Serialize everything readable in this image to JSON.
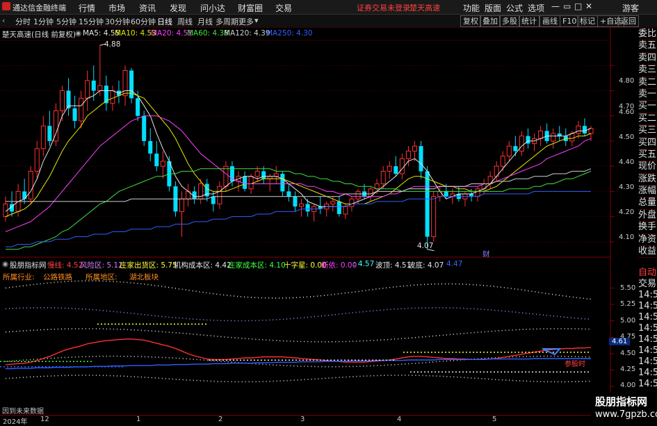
{
  "titlebar": {
    "app_name": "通达信金融终端",
    "menus": [
      "行情",
      "市场",
      "资讯",
      "发现",
      "问小达",
      "财富圈",
      "交易"
    ],
    "notice_login": "证券交易未登录",
    "notice_stock": "楚天高速",
    "right_menus": [
      "功能",
      "版面",
      "公式",
      "选项"
    ],
    "guest": "游客"
  },
  "toolbar": {
    "periods": [
      "分时",
      "1分钟",
      "5分钟",
      "15分钟",
      "30分钟",
      "60分钟",
      "日线",
      "周线",
      "月线",
      "多周期",
      "更多"
    ],
    "active": "日线",
    "right_buttons": [
      "复权",
      "叠加",
      "多股",
      "统计",
      "画线",
      "F10",
      "标记",
      "+自选",
      "返回"
    ]
  },
  "main": {
    "stock_title": "楚天高速(日线 前复权)",
    "ma_labels": [
      {
        "text": "MA5: 4.55",
        "color": "#e6e6e6"
      },
      {
        "text": "MA10: 4.53",
        "color": "#e6e600"
      },
      {
        "text": "MA20: 4.51",
        "color": "#ff40ff"
      },
      {
        "text": "MA60: 4.38",
        "color": "#40e040"
      },
      {
        "text": "MA120: 4.39",
        "color": "#d0d0d0"
      },
      {
        "text": "MA250: 4.30",
        "color": "#3060ff"
      }
    ],
    "high_label": "4.88",
    "low_label": "4.07",
    "cai_label": "财",
    "price_ticks": [
      "4.80",
      "4.70",
      "4.60",
      "4.50",
      "4.40",
      "4.30",
      "4.20",
      "4.10"
    ]
  },
  "indicator": {
    "name": "股朋指标网",
    "items": [
      {
        "text": "慢线: 4.52",
        "color": "#ff4040"
      },
      {
        "text": "风险区: 5.12",
        "color": "#d080ff"
      },
      {
        "text": "庄家出货区: 5.75",
        "color": "#ffff40"
      },
      {
        "text": "机构成本区: 4.42",
        "color": "#e6e6e6"
      },
      {
        "text": "庄家成本区: 4.10",
        "color": "#40ff40"
      },
      {
        "text": "十字星: 0.00",
        "color": "#ffff40"
      },
      {
        "text": "断依: 0.00",
        "color": "#ff40ff"
      },
      {
        "text": ": 4.57",
        "color": "#40ffff"
      },
      {
        "text": "波顶: 4.51",
        "color": "#e6e6e6"
      },
      {
        "text": "波底: 4.07",
        "color": "#e6e6e6"
      },
      {
        "text": "4.47",
        "color": "#4060ff"
      }
    ],
    "industry_label": "所属行业:",
    "industry_value": "公路铁路",
    "region_label": "所属地区:",
    "region_value": "湖北板块",
    "ticks": [
      "5.50",
      "5.25",
      "5.00",
      "4.75",
      "4.50",
      "4.25",
      "4.00"
    ],
    "current_value": "4.61",
    "buy_tag": "参股时",
    "footer_note": "因到未来数据"
  },
  "xaxis": {
    "labels": [
      "2024年",
      "12",
      "1",
      "2",
      "3",
      "4",
      "5"
    ]
  },
  "sidebar": {
    "items": [
      "委比",
      "卖五",
      "卖四",
      "卖三",
      "卖二",
      "卖一",
      "买一",
      "买二",
      "买三",
      "买四",
      "买五",
      "现价",
      "涨跌",
      "涨幅",
      "总量",
      "外盘",
      "换手",
      "净资",
      "收益"
    ],
    "lower": [
      "自动",
      "交易",
      "14:56",
      "14:56",
      "14:56",
      "14:56",
      "14:56",
      "14:56",
      "14:56",
      "14:56",
      "14:56"
    ]
  },
  "watermark": {
    "title": "股朋指标网",
    "url": "www.7gpzb.com"
  },
  "chart_data": {
    "type": "candlestick",
    "title": "楚天高速(日线 前复权)",
    "x_labels": [
      "2024年",
      "12",
      "1",
      "2",
      "3",
      "4",
      "5"
    ],
    "y_ticks": [
      4.1,
      4.2,
      4.3,
      4.4,
      4.5,
      4.6,
      4.7,
      4.8
    ],
    "ylim": [
      4.05,
      4.9
    ],
    "ohlc": [
      [
        4.2,
        4.28,
        4.18,
        4.25
      ],
      [
        4.25,
        4.3,
        4.2,
        4.22
      ],
      [
        4.22,
        4.33,
        4.2,
        4.3
      ],
      [
        4.3,
        4.35,
        4.25,
        4.27
      ],
      [
        4.27,
        4.4,
        4.25,
        4.38
      ],
      [
        4.38,
        4.5,
        4.35,
        4.47
      ],
      [
        4.47,
        4.6,
        4.44,
        4.56
      ],
      [
        4.56,
        4.62,
        4.48,
        4.5
      ],
      [
        4.5,
        4.65,
        4.48,
        4.62
      ],
      [
        4.62,
        4.72,
        4.58,
        4.7
      ],
      [
        4.7,
        4.75,
        4.6,
        4.63
      ],
      [
        4.63,
        4.68,
        4.55,
        4.58
      ],
      [
        4.58,
        4.7,
        4.55,
        4.67
      ],
      [
        4.67,
        4.78,
        4.62,
        4.74
      ],
      [
        4.74,
        4.8,
        4.66,
        4.7
      ],
      [
        4.7,
        4.88,
        4.68,
        4.72
      ],
      [
        4.72,
        4.76,
        4.62,
        4.65
      ],
      [
        4.65,
        4.72,
        4.62,
        4.7
      ],
      [
        4.7,
        4.74,
        4.65,
        4.68
      ],
      [
        4.68,
        4.8,
        4.64,
        4.78
      ],
      [
        4.78,
        4.79,
        4.65,
        4.67
      ],
      [
        4.67,
        4.7,
        4.58,
        4.6
      ],
      [
        4.6,
        4.62,
        4.48,
        4.5
      ],
      [
        4.5,
        4.55,
        4.42,
        4.45
      ],
      [
        4.45,
        4.5,
        4.38,
        4.4
      ],
      [
        4.4,
        4.46,
        4.35,
        4.42
      ],
      [
        4.42,
        4.44,
        4.3,
        4.32
      ],
      [
        4.32,
        4.34,
        4.2,
        4.22
      ],
      [
        4.22,
        4.3,
        4.12,
        4.27
      ],
      [
        4.27,
        4.33,
        4.24,
        4.3
      ],
      [
        4.3,
        4.32,
        4.25,
        4.27
      ],
      [
        4.27,
        4.35,
        4.25,
        4.33
      ],
      [
        4.33,
        4.35,
        4.26,
        4.28
      ],
      [
        4.28,
        4.3,
        4.22,
        4.25
      ],
      [
        4.25,
        4.34,
        4.23,
        4.32
      ],
      [
        4.32,
        4.42,
        4.3,
        4.4
      ],
      [
        4.4,
        4.42,
        4.32,
        4.34
      ],
      [
        4.34,
        4.38,
        4.3,
        4.36
      ],
      [
        4.36,
        4.38,
        4.3,
        4.31
      ],
      [
        4.31,
        4.37,
        4.29,
        4.36
      ],
      [
        4.36,
        4.4,
        4.34,
        4.38
      ],
      [
        4.38,
        4.4,
        4.33,
        4.35
      ],
      [
        4.35,
        4.37,
        4.3,
        4.36
      ],
      [
        4.36,
        4.4,
        4.33,
        4.37
      ],
      [
        4.37,
        4.38,
        4.28,
        4.3
      ],
      [
        4.3,
        4.33,
        4.26,
        4.28
      ],
      [
        4.28,
        4.3,
        4.22,
        4.24
      ],
      [
        4.24,
        4.27,
        4.2,
        4.25
      ],
      [
        4.25,
        4.27,
        4.2,
        4.22
      ],
      [
        4.22,
        4.25,
        4.18,
        4.24
      ],
      [
        4.24,
        4.28,
        4.21,
        4.23
      ],
      [
        4.23,
        4.26,
        4.2,
        4.25
      ],
      [
        4.25,
        4.28,
        4.22,
        4.26
      ],
      [
        4.26,
        4.28,
        4.2,
        4.21
      ],
      [
        4.21,
        4.25,
        4.19,
        4.24
      ],
      [
        4.24,
        4.28,
        4.22,
        4.27
      ],
      [
        4.27,
        4.31,
        4.25,
        4.3
      ],
      [
        4.3,
        4.33,
        4.27,
        4.28
      ],
      [
        4.28,
        4.32,
        4.26,
        4.31
      ],
      [
        4.31,
        4.35,
        4.29,
        4.33
      ],
      [
        4.33,
        4.4,
        4.31,
        4.38
      ],
      [
        4.38,
        4.42,
        4.35,
        4.4
      ],
      [
        4.4,
        4.44,
        4.36,
        4.37
      ],
      [
        4.37,
        4.45,
        4.35,
        4.43
      ],
      [
        4.43,
        4.48,
        4.4,
        4.46
      ],
      [
        4.46,
        4.5,
        4.42,
        4.48
      ],
      [
        4.48,
        4.5,
        4.35,
        4.38
      ],
      [
        4.38,
        4.4,
        4.07,
        4.12
      ],
      [
        4.12,
        4.3,
        4.1,
        4.28
      ],
      [
        4.28,
        4.32,
        4.26,
        4.3
      ],
      [
        4.3,
        4.33,
        4.27,
        4.28
      ],
      [
        4.28,
        4.31,
        4.25,
        4.29
      ],
      [
        4.29,
        4.32,
        4.26,
        4.27
      ],
      [
        4.27,
        4.3,
        4.24,
        4.29
      ],
      [
        4.29,
        4.31,
        4.26,
        4.28
      ],
      [
        4.28,
        4.32,
        4.26,
        4.31
      ],
      [
        4.31,
        4.35,
        4.29,
        4.33
      ],
      [
        4.33,
        4.38,
        4.31,
        4.36
      ],
      [
        4.36,
        4.42,
        4.34,
        4.4
      ],
      [
        4.4,
        4.46,
        4.38,
        4.44
      ],
      [
        4.44,
        4.5,
        4.42,
        4.48
      ],
      [
        4.48,
        4.52,
        4.44,
        4.46
      ],
      [
        4.46,
        4.54,
        4.44,
        4.52
      ],
      [
        4.52,
        4.55,
        4.47,
        4.49
      ],
      [
        4.49,
        4.53,
        4.46,
        4.51
      ],
      [
        4.51,
        4.56,
        4.48,
        4.54
      ],
      [
        4.54,
        4.57,
        4.49,
        4.5
      ],
      [
        4.5,
        4.55,
        4.47,
        4.53
      ],
      [
        4.53,
        4.56,
        4.5,
        4.52
      ],
      [
        4.52,
        4.55,
        4.48,
        4.5
      ],
      [
        4.5,
        4.54,
        4.48,
        4.53
      ],
      [
        4.53,
        4.58,
        4.51,
        4.56
      ],
      [
        4.56,
        4.59,
        4.52,
        4.53
      ],
      [
        4.53,
        4.56,
        4.5,
        4.55
      ]
    ],
    "series": [
      {
        "name": "MA5",
        "color": "#e6e6e6",
        "values": [
          4.22,
          4.24,
          4.26,
          4.27,
          4.3,
          4.35,
          4.42,
          4.47,
          4.53,
          4.6,
          4.64,
          4.64,
          4.64,
          4.67,
          4.68,
          4.7,
          4.7,
          4.7,
          4.69,
          4.7,
          4.7,
          4.68,
          4.64,
          4.6,
          4.53,
          4.47,
          4.42,
          4.36,
          4.32,
          4.3,
          4.28,
          4.28,
          4.29,
          4.29,
          4.3,
          4.32,
          4.34,
          4.35,
          4.36,
          4.36,
          4.35,
          4.36,
          4.36,
          4.36,
          4.35,
          4.33,
          4.31,
          4.29,
          4.26,
          4.25,
          4.24,
          4.24,
          4.24,
          4.24,
          4.24,
          4.25,
          4.26,
          4.27,
          4.28,
          4.3,
          4.32,
          4.34,
          4.36,
          4.39,
          4.42,
          4.43,
          4.41,
          4.38,
          4.34,
          4.3,
          4.27,
          4.28,
          4.29,
          4.29,
          4.29,
          4.3,
          4.31,
          4.33,
          4.36,
          4.39,
          4.42,
          4.45,
          4.48,
          4.5,
          4.5,
          4.51,
          4.52,
          4.52,
          4.52,
          4.52,
          4.53,
          4.54,
          4.54,
          4.55
        ]
      },
      {
        "name": "MA10",
        "color": "#e6e600",
        "values": [
          4.2,
          4.21,
          4.22,
          4.23,
          4.25,
          4.28,
          4.32,
          4.36,
          4.41,
          4.46,
          4.5,
          4.53,
          4.56,
          4.6,
          4.62,
          4.64,
          4.66,
          4.67,
          4.68,
          4.69,
          4.69,
          4.68,
          4.67,
          4.64,
          4.61,
          4.58,
          4.55,
          4.51,
          4.46,
          4.41,
          4.37,
          4.34,
          4.31,
          4.3,
          4.3,
          4.3,
          4.31,
          4.32,
          4.33,
          4.33,
          4.34,
          4.35,
          4.35,
          4.35,
          4.35,
          4.34,
          4.33,
          4.32,
          4.31,
          4.3,
          4.29,
          4.28,
          4.27,
          4.26,
          4.25,
          4.25,
          4.25,
          4.25,
          4.26,
          4.27,
          4.28,
          4.29,
          4.31,
          4.33,
          4.35,
          4.36,
          4.36,
          4.35,
          4.34,
          4.33,
          4.32,
          4.32,
          4.31,
          4.31,
          4.3,
          4.3,
          4.3,
          4.31,
          4.32,
          4.34,
          4.36,
          4.38,
          4.4,
          4.42,
          4.44,
          4.46,
          4.48,
          4.49,
          4.5,
          4.51,
          4.51,
          4.52,
          4.52,
          4.53
        ]
      },
      {
        "name": "MA20",
        "color": "#ff40ff",
        "values": [
          4.14,
          4.15,
          4.16,
          4.17,
          4.18,
          4.2,
          4.22,
          4.24,
          4.27,
          4.3,
          4.33,
          4.36,
          4.39,
          4.42,
          4.45,
          4.48,
          4.5,
          4.52,
          4.54,
          4.56,
          4.58,
          4.59,
          4.6,
          4.6,
          4.6,
          4.59,
          4.58,
          4.56,
          4.54,
          4.51,
          4.48,
          4.45,
          4.43,
          4.41,
          4.39,
          4.37,
          4.35,
          4.34,
          4.33,
          4.33,
          4.33,
          4.33,
          4.33,
          4.33,
          4.33,
          4.33,
          4.33,
          4.33,
          4.32,
          4.32,
          4.31,
          4.3,
          4.3,
          4.29,
          4.29,
          4.28,
          4.28,
          4.28,
          4.28,
          4.28,
          4.28,
          4.29,
          4.29,
          4.3,
          4.31,
          4.32,
          4.32,
          4.32,
          4.32,
          4.32,
          4.32,
          4.32,
          4.32,
          4.32,
          4.32,
          4.32,
          4.33,
          4.33,
          4.34,
          4.35,
          4.36,
          4.37,
          4.38,
          4.39,
          4.4,
          4.41,
          4.43,
          4.44,
          4.45,
          4.46,
          4.47,
          4.48,
          4.5,
          4.51
        ]
      },
      {
        "name": "MA60",
        "color": "#40e040",
        "values": [
          4.07,
          4.07,
          4.07,
          4.08,
          4.08,
          4.09,
          4.1,
          4.11,
          4.12,
          4.14,
          4.15,
          4.17,
          4.19,
          4.21,
          4.23,
          4.25,
          4.26,
          4.28,
          4.3,
          4.31,
          4.32,
          4.33,
          4.34,
          4.35,
          4.36,
          4.36,
          4.37,
          4.37,
          4.38,
          4.38,
          4.38,
          4.39,
          4.39,
          4.39,
          4.39,
          4.39,
          4.39,
          4.39,
          4.39,
          4.39,
          4.39,
          4.39,
          4.39,
          4.38,
          4.38,
          4.38,
          4.37,
          4.37,
          4.36,
          4.36,
          4.35,
          4.35,
          4.34,
          4.34,
          4.33,
          4.33,
          4.32,
          4.32,
          4.32,
          4.31,
          4.31,
          4.31,
          4.31,
          4.3,
          4.3,
          4.3,
          4.3,
          4.3,
          4.3,
          4.3,
          4.3,
          4.3,
          4.3,
          4.3,
          4.3,
          4.3,
          4.3,
          4.3,
          4.3,
          4.3,
          4.31,
          4.31,
          4.31,
          4.31,
          4.32,
          4.32,
          4.33,
          4.33,
          4.34,
          4.35,
          4.35,
          4.36,
          4.37,
          4.38
        ]
      },
      {
        "name": "MA120",
        "color": "#d0d0d0",
        "values": [
          4.26,
          4.26,
          4.26,
          4.26,
          4.26,
          4.26,
          4.26,
          4.26,
          4.26,
          4.26,
          4.26,
          4.26,
          4.26,
          4.26,
          4.26,
          4.26,
          4.26,
          4.26,
          4.26,
          4.26,
          4.27,
          4.27,
          4.27,
          4.27,
          4.27,
          4.27,
          4.27,
          4.27,
          4.27,
          4.27,
          4.27,
          4.27,
          4.27,
          4.28,
          4.28,
          4.28,
          4.28,
          4.28,
          4.28,
          4.28,
          4.28,
          4.28,
          4.28,
          4.28,
          4.28,
          4.28,
          4.28,
          4.28,
          4.28,
          4.28,
          4.28,
          4.28,
          4.28,
          4.28,
          4.29,
          4.29,
          4.29,
          4.29,
          4.29,
          4.3,
          4.3,
          4.3,
          4.3,
          4.3,
          4.31,
          4.31,
          4.31,
          4.31,
          4.31,
          4.32,
          4.32,
          4.32,
          4.32,
          4.32,
          4.33,
          4.33,
          4.33,
          4.33,
          4.34,
          4.34,
          4.34,
          4.35,
          4.35,
          4.35,
          4.36,
          4.36,
          4.36,
          4.37,
          4.37,
          4.37,
          4.38,
          4.38,
          4.38,
          4.39
        ]
      },
      {
        "name": "MA250",
        "color": "#3060ff",
        "values": [
          4.08,
          4.08,
          4.09,
          4.09,
          4.09,
          4.1,
          4.1,
          4.1,
          4.11,
          4.11,
          4.11,
          4.12,
          4.12,
          4.12,
          4.13,
          4.13,
          4.13,
          4.14,
          4.14,
          4.14,
          4.15,
          4.15,
          4.15,
          4.15,
          4.16,
          4.16,
          4.16,
          4.17,
          4.17,
          4.17,
          4.18,
          4.18,
          4.18,
          4.19,
          4.19,
          4.19,
          4.2,
          4.2,
          4.2,
          4.2,
          4.21,
          4.21,
          4.21,
          4.22,
          4.22,
          4.22,
          4.22,
          4.23,
          4.23,
          4.23,
          4.23,
          4.24,
          4.24,
          4.24,
          4.24,
          4.25,
          4.25,
          4.25,
          4.25,
          4.26,
          4.26,
          4.26,
          4.26,
          4.26,
          4.27,
          4.27,
          4.27,
          4.27,
          4.27,
          4.28,
          4.28,
          4.28,
          4.28,
          4.28,
          4.28,
          4.28,
          4.29,
          4.29,
          4.29,
          4.29,
          4.29,
          4.29,
          4.29,
          4.29,
          4.3,
          4.3,
          4.3,
          4.3,
          4.3,
          4.3,
          4.3,
          4.3,
          4.3,
          4.3
        ]
      }
    ]
  }
}
